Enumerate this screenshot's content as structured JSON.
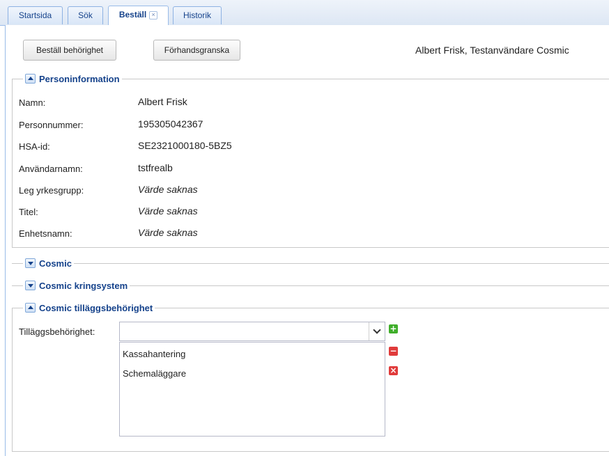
{
  "tabs": [
    {
      "label": "Startsida"
    },
    {
      "label": "Sök"
    },
    {
      "label": "Beställ",
      "close": "×"
    },
    {
      "label": "Historik"
    }
  ],
  "toolbar": {
    "order_button": "Beställ behörighet",
    "preview_button": "Förhandsgranska",
    "user_info": "Albert Frisk, Testanvändare Cosmic"
  },
  "person": {
    "legend": "Personinformation",
    "fields": [
      {
        "label": "Namn:",
        "value": "Albert Frisk"
      },
      {
        "label": "Personnummer:",
        "value": "195305042367"
      },
      {
        "label": "HSA-id:",
        "value": "SE2321000180-5BZ5"
      },
      {
        "label": "Användarnamn:",
        "value": "tstfrealb"
      },
      {
        "label": "Leg yrkesgrupp:",
        "value": "Värde saknas"
      },
      {
        "label": "Titel:",
        "value": "Värde saknas"
      },
      {
        "label": "Enhetsnamn:",
        "value": "Värde saknas"
      }
    ]
  },
  "sections": {
    "cosmic": "Cosmic",
    "kringsystem": "Cosmic kringsystem",
    "tillagg": "Cosmic tilläggsbehörighet"
  },
  "tillagg": {
    "label": "Tilläggsbehörighet:",
    "input_value": "",
    "items": [
      "Kassahantering",
      "Schemaläggare"
    ],
    "add_glyph": "+",
    "remove_glyph": "−",
    "clear_glyph": "×"
  },
  "colors": {
    "accent": "#15428b",
    "add": "#3fae2a",
    "remove": "#e03b3b"
  }
}
